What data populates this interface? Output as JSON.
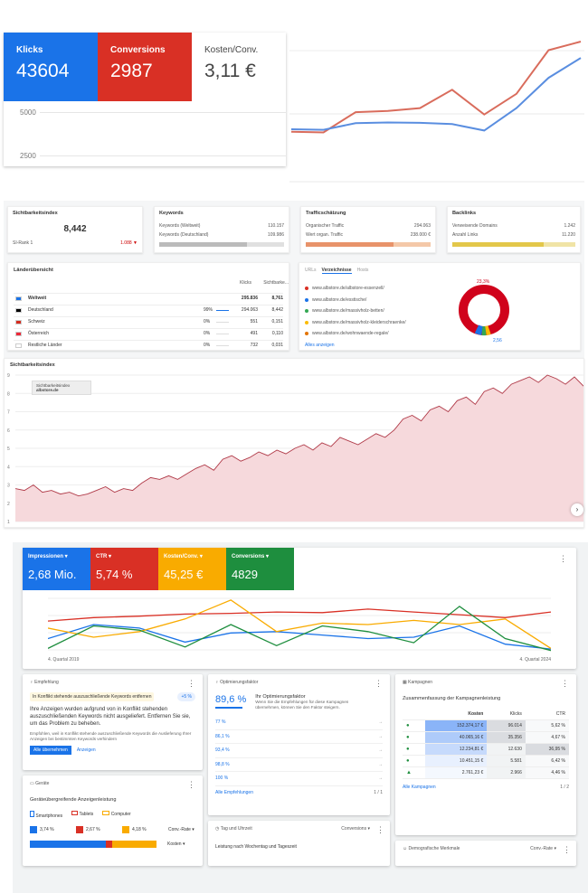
{
  "panel1": {
    "tiles": [
      {
        "label": "Klicks",
        "value": "43604",
        "color": "#1a73e8"
      },
      {
        "label": "Conversions",
        "value": "2987",
        "color": "#d93025"
      },
      {
        "label": "Kosten/Conv.",
        "value": "3,11 €",
        "color": "#ffffff"
      }
    ],
    "yticks": [
      "5000",
      "2500"
    ],
    "chart_data": {
      "type": "line",
      "x": [
        1,
        2,
        3,
        4,
        5,
        6,
        7,
        8,
        9,
        10
      ],
      "series": [
        {
          "color": "#d96c5c",
          "values": [
            2720,
            2680,
            3780,
            3850,
            4000,
            5000,
            3650,
            4780,
            7150,
            7620
          ]
        },
        {
          "color": "#5a8ee0",
          "values": [
            2850,
            2820,
            3180,
            3220,
            3200,
            3130,
            2780,
            4000,
            5650,
            6730
          ]
        }
      ]
    }
  },
  "panel2": {
    "sichtbarkeit": {
      "title": "Sichtbarkeitsindex",
      "value": "8,442",
      "rank_label": "SI-Rank 1",
      "rank_value": "1.088 ▼"
    },
    "keywords": {
      "title": "Keywords",
      "rows": [
        [
          "Keywords (Weltweit)",
          "110.157"
        ],
        [
          "Keywords (Deutschland)",
          "109.986"
        ]
      ]
    },
    "traffic": {
      "title": "Trafficschätzung",
      "rows": [
        [
          "Organischer Traffic",
          "294.063"
        ],
        [
          "Wert organ. Traffic",
          "238.000 €"
        ]
      ]
    },
    "backlinks": {
      "title": "Backlinks",
      "rows": [
        [
          "Verweisende Domains",
          "1.242"
        ],
        [
          "Anzahl Links",
          "11.220"
        ]
      ]
    },
    "laender": {
      "title": "Länderübersicht",
      "headers": [
        "Klicks",
        "Sichtbarke..."
      ],
      "rows": [
        {
          "name": "Weltweit",
          "pct": "",
          "klicks": "295.836",
          "si": "8,761",
          "flag": "#1a73e8"
        },
        {
          "name": "Deutschland",
          "pct": "99%",
          "klicks": "294.063",
          "si": "8,442",
          "flag": "#000000"
        },
        {
          "name": "Schweiz",
          "pct": "0%",
          "klicks": "551",
          "si": "0,151",
          "flag": "#d52b1e"
        },
        {
          "name": "Österreich",
          "pct": "0%",
          "klicks": "491",
          "si": "0,110",
          "flag": "#ed2939"
        },
        {
          "name": "Restliche Länder",
          "pct": "0%",
          "klicks": "732",
          "si": "0,031",
          "flag": "#ffffff"
        }
      ]
    },
    "urls": {
      "tabs": [
        "URLs",
        "Verzeichnisse",
        "Hosts"
      ],
      "items": [
        {
          "text": "www.albstore.de/albstore-essenzell/",
          "color": "#d93025"
        },
        {
          "text": "www.albstore.de/esstische/",
          "color": "#1a73e8"
        },
        {
          "text": "www.albstore.de/massivholz-betten/",
          "color": "#34a853"
        },
        {
          "text": "www.albstore.de/massivholz-kleiderschraenke/",
          "color": "#fbbc04"
        },
        {
          "text": "www.albstore.de/wohnwaende-regale/",
          "color": "#e37400"
        }
      ],
      "show_all": "Alles anzeigen",
      "donut_top": "23,3%",
      "donut_bottom": "2,56"
    },
    "si_chart": {
      "title": "Sichtbarkeitsindex",
      "legend_line1": "Sichtbarkeitsindex",
      "legend_line2": "albstore.de",
      "yticks": [
        "9",
        "8",
        "7",
        "6",
        "5",
        "4",
        "3",
        "2",
        "1"
      ],
      "chart_data": {
        "type": "area",
        "ylim": [
          1,
          9
        ],
        "values": [
          2.8,
          2.7,
          3.0,
          2.6,
          2.7,
          2.5,
          2.6,
          2.4,
          2.5,
          2.7,
          2.9,
          2.6,
          2.8,
          2.7,
          3.1,
          3.4,
          3.3,
          3.5,
          3.3,
          3.6,
          3.9,
          4.1,
          3.8,
          4.4,
          4.6,
          4.3,
          4.5,
          4.8,
          4.6,
          4.9,
          4.7,
          5.0,
          5.2,
          4.9,
          5.3,
          5.1,
          5.6,
          5.4,
          5.2,
          5.5,
          5.8,
          5.6,
          6.0,
          6.6,
          6.8,
          6.5,
          7.1,
          7.3,
          7.0,
          7.6,
          7.8,
          7.4,
          8.1,
          8.3,
          8.0,
          8.5,
          8.7,
          8.9,
          8.6,
          9.0,
          8.8,
          8.5,
          8.9,
          8.4
        ]
      }
    }
  },
  "panel3": {
    "metrics": [
      {
        "label": "Impressionen ▾",
        "value": "2,68 Mio.",
        "color": "#1a73e8"
      },
      {
        "label": "CTR ▾",
        "value": "5,74 %",
        "color": "#d93025"
      },
      {
        "label": "Kosten/Conv. ▾",
        "value": "45,25 €",
        "color": "#f9ab00"
      },
      {
        "label": "Conversions ▾",
        "value": "4829",
        "color": "#1e8e3e"
      }
    ],
    "x_start": "4. Quartal 2019",
    "x_end": "4. Quartal 2024",
    "chart_data": {
      "type": "line",
      "x": [
        1,
        2,
        3,
        4,
        5,
        6,
        7,
        8,
        9,
        10,
        11,
        12
      ],
      "series": [
        {
          "color": "#1a73e8",
          "values": [
            20,
            40,
            35,
            15,
            28,
            30,
            25,
            20,
            22,
            38,
            12,
            5
          ]
        },
        {
          "color": "#d93025",
          "values": [
            45,
            50,
            52,
            55,
            56,
            58,
            57,
            62,
            58,
            54,
            50,
            58
          ]
        },
        {
          "color": "#f9ab00",
          "values": [
            35,
            22,
            30,
            48,
            75,
            30,
            42,
            40,
            46,
            40,
            48,
            6
          ]
        },
        {
          "color": "#1e8e3e",
          "values": [
            6,
            38,
            32,
            8,
            40,
            10,
            38,
            30,
            14,
            66,
            20,
            3
          ]
        }
      ]
    },
    "empfehlung": {
      "title": "Empfehlung",
      "badge_text": "In Konflikt stehende auszuschließende Keywords entfernen",
      "badge_pct": "+5 %",
      "body": "Ihre Anzeigen wurden aufgrund von in Konflikt stehenden auszuschließenden Keywords nicht ausgeliefert. Entfernen Sie sie, um das Problem zu beheben.",
      "small": "Empfohlen, weil in Konflikt stehende auszuschließende Keywords die Auslieferung Ihrer Anzeigen bei bestimmten Keywords verhindern",
      "btn_apply": "Alle übernehmen",
      "btn_show": "Anzeigen"
    },
    "opt": {
      "title": "Optimierungsfaktor",
      "pct": "89,6 %",
      "heading": "Ihr Optimierungsfaktor",
      "desc": "Wenn Sie die Empfehlungen für diese Kampagnen übernehmen, können Sie den Faktor steigern.",
      "rows": [
        "77 %",
        "86,1 %",
        "93,4 %",
        "98,8 %",
        "100 %"
      ],
      "link": "Alle Empfehlungen",
      "pager": "1 / 1"
    },
    "kampagnen": {
      "title": "Kampagnen",
      "subtitle": "Zusammenfassung der Kampagnenleistung",
      "headers": [
        "Kosten",
        "Klicks",
        "CTR"
      ],
      "rows": [
        [
          "152.374,17 €",
          "96.014",
          "5,62 %"
        ],
        [
          "40.065,16 €",
          "35.356",
          "4,67 %"
        ],
        [
          "12.234,81 €",
          "12.630",
          "36,95 %"
        ],
        [
          "10.451,15 €",
          "5.581",
          "6,42 %"
        ],
        [
          "2.761,23 €",
          "2.966",
          "4,46 %"
        ]
      ],
      "link": "Alle Kampagnen",
      "pager": "1 / 2"
    },
    "geraete": {
      "title": "Geräte",
      "subtitle": "Geräteübergreifende Anzeigenleistung",
      "legend": [
        {
          "label": "Smartphones",
          "color": "#1a73e8"
        },
        {
          "label": "Tablets",
          "color": "#d93025"
        },
        {
          "label": "Computer",
          "color": "#f9ab00"
        }
      ],
      "values": [
        "3,74 %",
        "2,67 %",
        "4,18 %"
      ],
      "select1": "Conv.-Rate ▾",
      "select2": "Kosten ▾"
    },
    "tag": {
      "title": "Tag und Uhrzeit",
      "select": "Conversions ▾",
      "heading": "Leistung nach Wochentag und Tageszeit"
    },
    "demo": {
      "title": "Demografische Merkmale",
      "select": "Conv.-Rate ▾"
    },
    "more_icon": "⋮"
  }
}
